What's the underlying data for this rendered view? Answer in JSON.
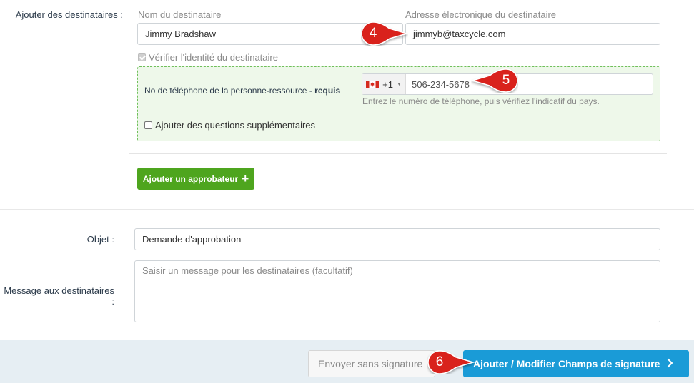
{
  "recipients": {
    "section_label": "Ajouter des destinataires :",
    "name_caption": "Nom du destinataire",
    "email_caption": "Adresse électronique du destinataire",
    "name_value": "Jimmy Bradshaw",
    "email_value": "jimmyb@taxcycle.com",
    "verify_label": "Vérifier l'identité du destinataire",
    "verify_checked": true
  },
  "verification": {
    "phone_label": "No de téléphone de la personne-ressource",
    "required_sep": " - ",
    "required_label": "requis",
    "country_code": "+1",
    "flag_icon": "canada-flag-icon",
    "phone_value": "506-234-5678",
    "phone_help": "Entrez le numéro de téléphone, puis vérifiez l'indicatif du pays.",
    "extra_questions_label": "Ajouter des questions supplémentaires",
    "extra_questions_checked": false,
    "border_color": "#6fbf5a",
    "bg_color": "#eef8ea"
  },
  "approver": {
    "button_label": "Ajouter un approbateur",
    "button_icon": "plus-icon",
    "button_color": "#4ea51e"
  },
  "subject": {
    "label": "Objet :",
    "value": "Demande d'approbation"
  },
  "message": {
    "label": "Message aux destinataires :",
    "placeholder": "Saisir un message pour les destinataires (facultatif)"
  },
  "footer": {
    "send_unsigned_label": "Envoyer sans signature",
    "add_fields_label": "Ajouter / Modifier Champs de signature",
    "add_fields_icon": "chevron-right-icon",
    "primary_color": "#1a9bd7",
    "bar_color": "#e6eef3"
  },
  "callouts": {
    "c4": "4",
    "c5": "5",
    "c6": "6",
    "color": "#d9201f"
  }
}
